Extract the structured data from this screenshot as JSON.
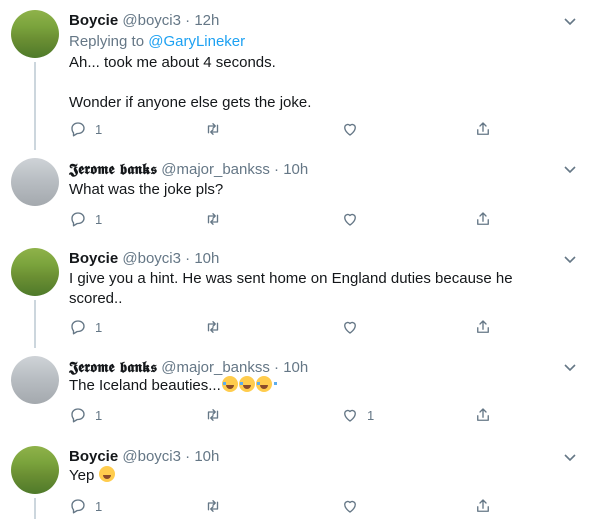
{
  "tweets": [
    {
      "name": "Boycie",
      "handle": "@boyci3",
      "dot": "·",
      "time": "12h",
      "reply_prefix": "Replying to",
      "reply_mention": "@GaryLineker",
      "lines": [
        "Ah... took me about 4 seconds.",
        "Wonder if anyone else gets the joke."
      ],
      "reply_count": "1",
      "like_count": ""
    },
    {
      "name": "𝕵𝖊𝖗𝖔𝖒𝖊 𝖇𝖆𝖓𝖐𝖘",
      "handle": "@major_bankss",
      "dot": "·",
      "time": "10h",
      "lines": [
        "What was the joke pls?"
      ],
      "reply_count": "1",
      "like_count": ""
    },
    {
      "name": "Boycie",
      "handle": "@boyci3",
      "dot": "·",
      "time": "10h",
      "lines": [
        "I give you a hint. He was sent home on England duties because he scored.."
      ],
      "reply_count": "1",
      "like_count": ""
    },
    {
      "name": "𝕵𝖊𝖗𝖔𝖒𝖊 𝖇𝖆𝖓𝖐𝖘",
      "handle": "@major_bankss",
      "dot": "·",
      "time": "10h",
      "lines": [
        "The Iceland beauties..."
      ],
      "emojis": [
        "face-with-tears-of-joy",
        "face-with-tears-of-joy",
        "face-with-tears-of-joy"
      ],
      "reply_count": "1",
      "like_count": "1"
    },
    {
      "name": "Boycie",
      "handle": "@boyci3",
      "dot": "·",
      "time": "10h",
      "lines": [
        "Yep"
      ],
      "emojis": [
        "grinning-squinting-face"
      ],
      "reply_count": "1",
      "like_count": ""
    }
  ],
  "colors": {
    "text": "#14171a",
    "muted": "#657786",
    "link": "#1da1f2",
    "thread_line": "#ccd6dd"
  },
  "icons": {
    "reply": "reply-icon",
    "retweet": "retweet-icon",
    "like": "like-icon",
    "share": "share-icon",
    "more": "chevron-down-icon"
  }
}
